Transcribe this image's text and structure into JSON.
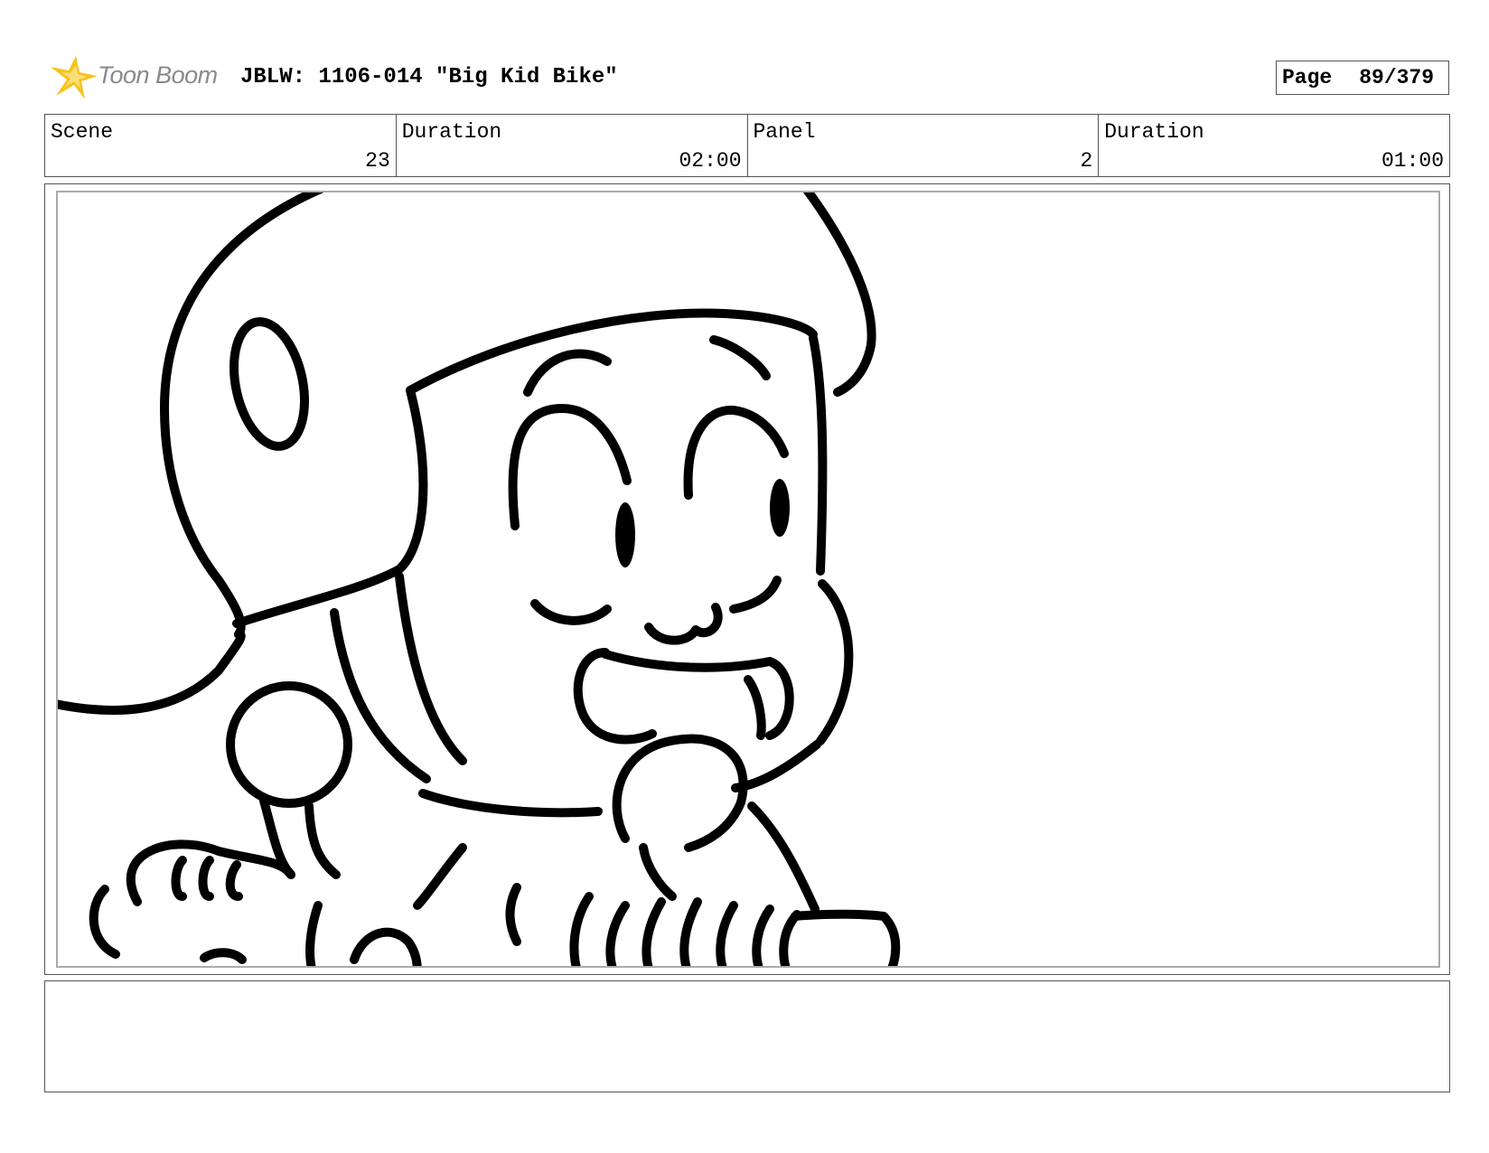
{
  "header": {
    "logo_text": "Toon Boom",
    "title": "JBLW: 1106-014 \"Big Kid Bike\"",
    "page_label": "Page",
    "page_value": "89/379"
  },
  "info": {
    "scene_label": "Scene",
    "scene_value": "23",
    "scene_duration_label": "Duration",
    "scene_duration_value": "02:00",
    "panel_label": "Panel",
    "panel_value": "2",
    "panel_duration_label": "Duration",
    "panel_duration_value": "01:00"
  },
  "notes": {
    "text": ""
  },
  "colors": {
    "logo_star": "#f7c21a",
    "logo_text": "#8a8a8a",
    "ink": "#000000",
    "frame_border": "#555555"
  },
  "icons": {
    "logo": "toon-boom-star-icon"
  }
}
